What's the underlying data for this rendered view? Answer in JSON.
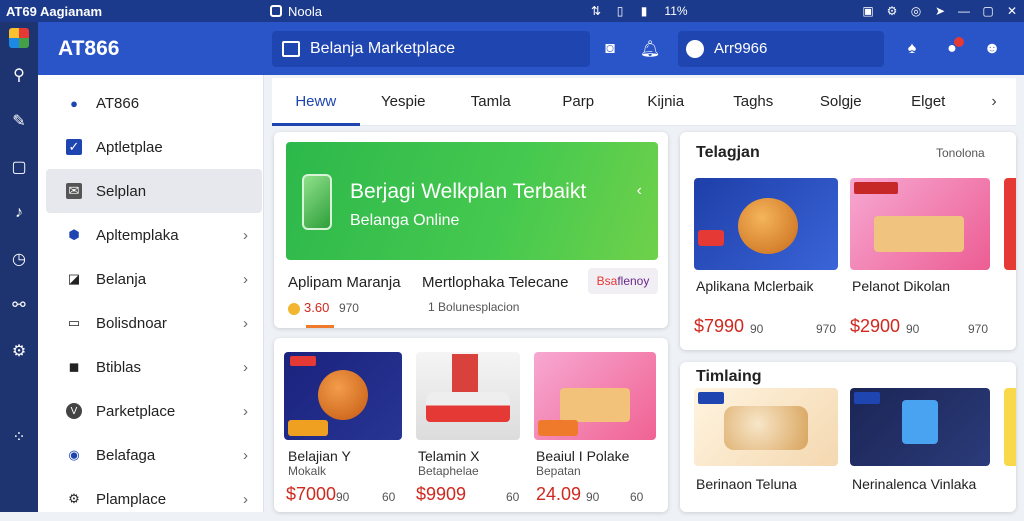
{
  "titlebar": {
    "app_title": "AT69 Aagianam",
    "window_title": "Noola",
    "status": "11%"
  },
  "header": {
    "brand": "AT866",
    "search_label": "Belanja Marketplace",
    "user_label": "Arr9966"
  },
  "sidebar": {
    "items": [
      {
        "label": "AT866",
        "icon": "globe-icon",
        "chevron": false
      },
      {
        "label": "Aptletplae",
        "icon": "check-icon",
        "chevron": false
      },
      {
        "label": "Selplan",
        "icon": "mail-icon",
        "chevron": false,
        "active": true
      },
      {
        "label": "Apltemplaka",
        "icon": "shield-icon",
        "chevron": true
      },
      {
        "label": "Belanja",
        "icon": "chart-icon",
        "chevron": true
      },
      {
        "label": "Bolisdnoar",
        "icon": "monitor-icon",
        "chevron": true
      },
      {
        "label": "Btiblas",
        "icon": "bag-icon",
        "chevron": true
      },
      {
        "label": "Parketplace",
        "icon": "v-icon",
        "chevron": true
      },
      {
        "label": "Belafaga",
        "icon": "info-icon",
        "chevron": true
      },
      {
        "label": "Plamplace",
        "icon": "gear-icon",
        "chevron": true
      }
    ]
  },
  "tabs": [
    "Heww",
    "Yespie",
    "Tamla",
    "Parp",
    "Kijnia",
    "Taghs",
    "Solgje",
    "Elget"
  ],
  "featured": {
    "banner_title": "Berjagi Welkplan Terbaikt",
    "banner_subtitle": "Belanga Online",
    "product_name": "Aplipam Maranja",
    "product_name2": "Mertlophaka Telecane",
    "tag_prefix": "Bsa",
    "tag_suffix": "flenoy",
    "coin_value": "3.60",
    "coin_count": "970",
    "shop_note": "Bolunesplacion",
    "shop_count": "1"
  },
  "bottom_products": [
    {
      "tag": "",
      "title": "Belajian Y",
      "sub": "Mokalk",
      "price": "$7000",
      "meta1": "90",
      "meta2": "60"
    },
    {
      "tag": "",
      "title": "Telamin X",
      "sub": "Betaphelae",
      "price": "$9909",
      "meta1": "",
      "meta2": "60"
    },
    {
      "tag": "",
      "title": "Beaiul I Polake",
      "sub": "Bepatan",
      "price": "24.09",
      "meta1": "90",
      "meta2": "60"
    }
  ],
  "section1": {
    "title": "Telagjan",
    "link": "Tonolona",
    "products": [
      {
        "title": "Aplikana Mclerbaik",
        "price": "$7990",
        "meta1": "90",
        "meta2": "970"
      },
      {
        "title": "Pelanot Dikolan",
        "price": "$2900",
        "meta1": "90",
        "meta2": "970"
      }
    ]
  },
  "section2": {
    "title": "Timlaing",
    "products": [
      {
        "title": "Berinaon Teluna"
      },
      {
        "title": "Nerinalenca Vinlaka"
      }
    ]
  },
  "colors": {
    "primary": "#2a55c9",
    "rail": "#1e3470",
    "price": "#d0281e",
    "banner": "#3cbf4d"
  }
}
